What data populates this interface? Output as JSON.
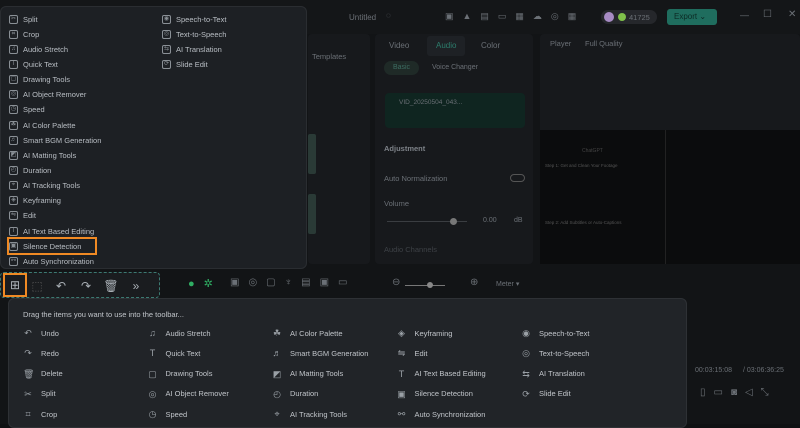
{
  "header": {
    "title": "Untitled",
    "credits": "41725",
    "export_label": "Export"
  },
  "media_panel": {
    "templates_label": "Templates"
  },
  "properties": {
    "tabs": [
      "Video",
      "Audio",
      "Color"
    ],
    "active_tab": "Audio",
    "subtabs": [
      "Basic",
      "Voice Changer"
    ],
    "clip_name": "VID_20250504_043...",
    "adjustment": "Adjustment",
    "auto_normalization": "Auto Normalization",
    "volume": "Volume",
    "volume_value": "0.00",
    "volume_unit": "dB",
    "audio_channels": "Audio Channels"
  },
  "player": {
    "label": "Player",
    "quality": "Full Quality",
    "current_time": "00:03:15:08",
    "total_time": "/ 03:06:36:25",
    "preview_texts": [
      "ChatGPT",
      "Step 1: Get and Clean Your Footage",
      "Step 2: Add Subtitles or Auto-Captions"
    ]
  },
  "timeline": {
    "meter_label": "Meter"
  },
  "menu": {
    "col1": [
      "Split",
      "Crop",
      "Audio Stretch",
      "Quick Text",
      "Drawing Tools",
      "AI Object Remover",
      "Speed",
      "AI Color Palette",
      "Smart BGM Generation",
      "AI Matting Tools",
      "Duration",
      "AI Tracking Tools",
      "Keyframing",
      "Edit",
      "AI Text Based Editing",
      "Silence Detection",
      "Auto Synchronization"
    ],
    "col2": [
      "Speech-to-Text",
      "Text-to-Speech",
      "AI Translation",
      "Slide Edit"
    ],
    "highlighted": "Silence Detection"
  },
  "drag_panel": {
    "hint": "Drag the items you want to use into the toolbar...",
    "columns": [
      [
        "Undo",
        "Redo",
        "Delete",
        "Split",
        "Crop"
      ],
      [
        "Audio Stretch",
        "Quick Text",
        "Drawing Tools",
        "AI Object Remover",
        "Speed"
      ],
      [
        "AI Color Palette",
        "Smart BGM Generation",
        "AI Matting Tools",
        "Duration",
        "AI Tracking Tools"
      ],
      [
        "Keyframing",
        "Edit",
        "AI Text Based Editing",
        "Silence Detection",
        "Auto Synchronization"
      ],
      [
        "Speech-to-Text",
        "Text-to-Speech",
        "AI Translation",
        "Slide Edit"
      ]
    ]
  },
  "colors": {
    "accent": "#2fb89a",
    "highlight": "#f08a24"
  }
}
